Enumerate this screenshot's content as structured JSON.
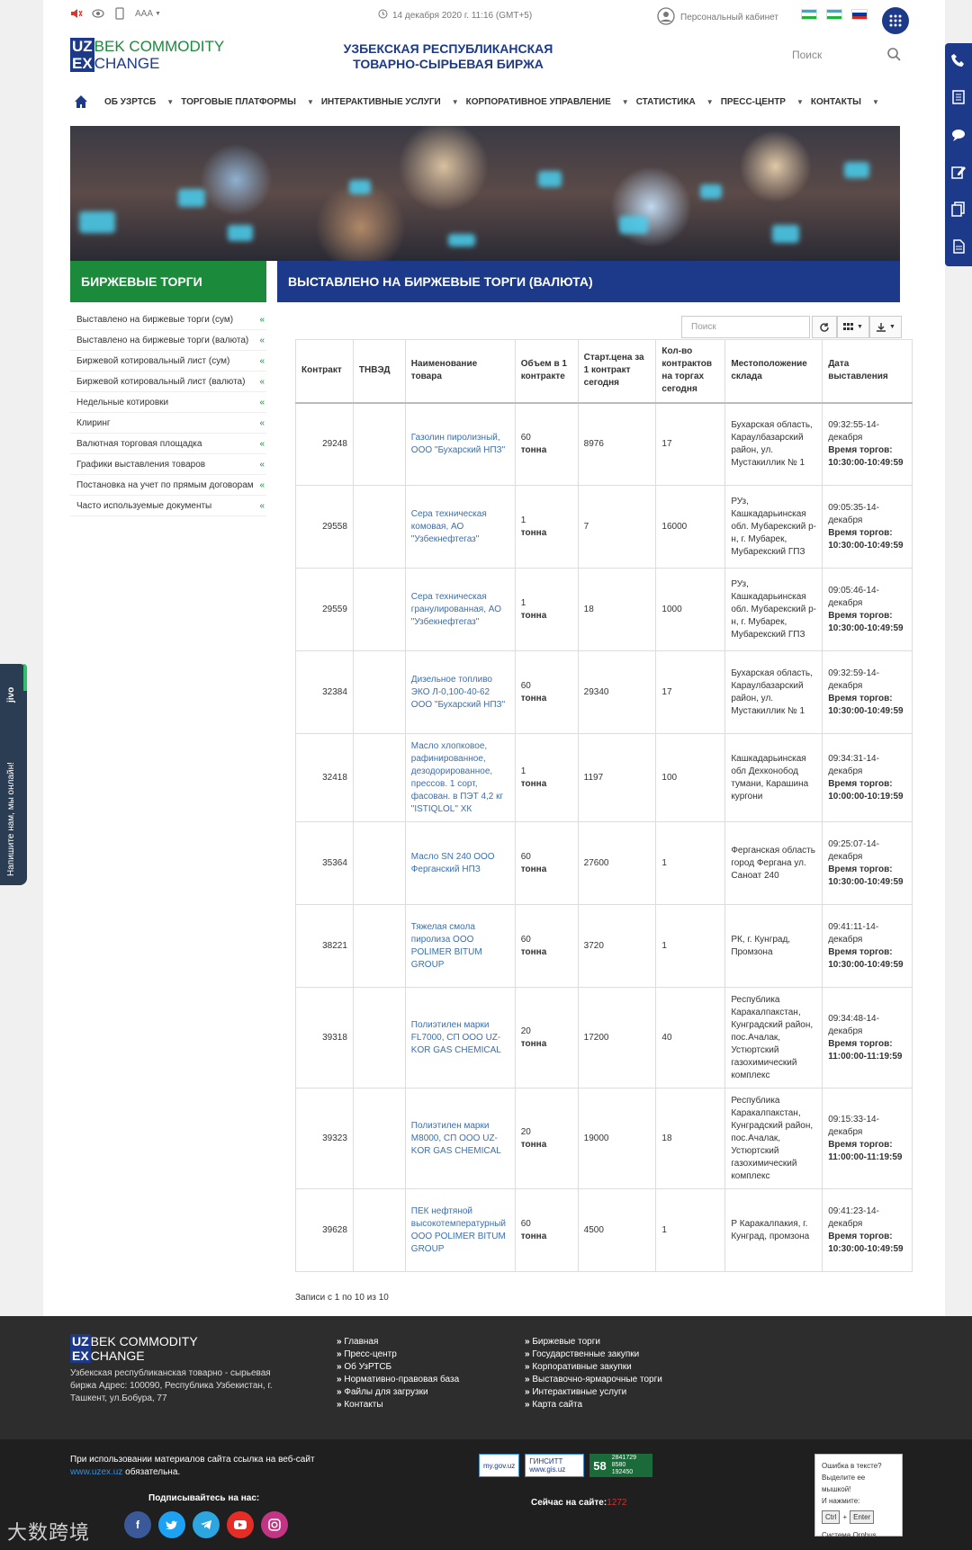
{
  "topbar": {
    "font_size_label": "AAA",
    "date": "14 декабря 2020 г. 11:16 (GMT+5)",
    "cabinet": "Персональный кабинет"
  },
  "header": {
    "logo": {
      "box1": "UZ",
      "text1": "BEK COMMODITY",
      "box2": "EX",
      "text2": "CHANGE"
    },
    "title": "УЗБЕКСКАЯ РЕСПУБЛИКАНСКАЯ ТОВАРНО-СЫРЬЕВАЯ БИРЖА",
    "search_placeholder": "Поиск"
  },
  "nav": [
    "ОБ УЗРТСБ",
    "ТОРГОВЫЕ ПЛАТФОРМЫ",
    "ИНТЕРАКТИВНЫЕ УСЛУГИ",
    "КОРПОРАТИВНОЕ УПРАВЛЕНИЕ",
    "СТАТИСТИКА",
    "ПРЕСС-ЦЕНТР",
    "КОНТАКТЫ"
  ],
  "section": {
    "left_title": "БИРЖЕВЫЕ ТОРГИ",
    "right_title": "ВЫСТАВЛЕНО НА БИРЖЕВЫЕ ТОРГИ (ВАЛЮТА)"
  },
  "left_menu": [
    "Выставлено на биржевые торги (сум)",
    "Выставлено на биржевые торги (валюта)",
    "Биржевой котировальный лист (сум)",
    "Биржевой котировальный лист (валюта)",
    "Недельные котировки",
    "Клиринг",
    "Валютная торговая площадка",
    "Графики выставления товаров",
    "Постановка на учет по прямым договорам",
    "Часто используемые документы"
  ],
  "table": {
    "search_placeholder": "Поиск",
    "columns": [
      "Контракт",
      "ТНВЭД",
      "Наименование товара",
      "Объем в 1 контракте",
      "Старт.цена за 1 контракт сегодня",
      "Кол-во контрактов на торгах сегодня",
      "Местоположение склада",
      "Дата выставления"
    ],
    "trade_time_label": "Время торгов:",
    "rows": [
      {
        "contract": "29248",
        "tnved": "",
        "name": "Газолин пиролизный, ООО \"Бухарский НПЗ\"",
        "volume": "60",
        "unit": "тонна",
        "price": "8976",
        "count": "17",
        "location": "Бухарская область, Караулбазарский район, ул. Мустакиллик № 1",
        "date": "09:32:55-14-декабря",
        "trade_time": "10:30:00-10:49:59"
      },
      {
        "contract": "29558",
        "tnved": "",
        "name": "Сера техническая комовая, АО \"Узбекнефтегаз\"",
        "volume": "1",
        "unit": "тонна",
        "price": "7",
        "count": "16000",
        "location": "РУз, Кашкадарьинская обл. Мубарекский р-н, г. Мубарек, Мубарекский ГПЗ",
        "date": "09:05:35-14-декабря",
        "trade_time": "10:30:00-10:49:59"
      },
      {
        "contract": "29559",
        "tnved": "",
        "name": "Сера техническая гранулированная, АО \"Узбекнефтегаз\"",
        "volume": "1",
        "unit": "тонна",
        "price": "18",
        "count": "1000",
        "location": "РУз, Кашкадарьинская обл. Мубарекский р-н, г. Мубарек, Мубарекский ГПЗ",
        "date": "09:05:46-14-декабря",
        "trade_time": "10:30:00-10:49:59"
      },
      {
        "contract": "32384",
        "tnved": "",
        "name": "Дизельное топливо ЭКО Л-0,100-40-62 ООО \"Бухарский НПЗ\"",
        "volume": "60",
        "unit": "тонна",
        "price": "29340",
        "count": "17",
        "location": "Бухарская область, Караулбазарский район, ул. Мустакиллик № 1",
        "date": "09:32:59-14-декабря",
        "trade_time": "10:30:00-10:49:59"
      },
      {
        "contract": "32418",
        "tnved": "",
        "name": "Масло хлопковое, рафинированное, дезодорированное, прессов. 1 сорт, фасован. в ПЭТ 4,2 кг \"ISTIQLOL\" ХК",
        "volume": "1",
        "unit": "тонна",
        "price": "1197",
        "count": "100",
        "location": "Кашкадарьинская обл Дехконобод тумани, Карашина кургони",
        "date": "09:34:31-14-декабря",
        "trade_time": "10:00:00-10:19:59"
      },
      {
        "contract": "35364",
        "tnved": "",
        "name": "Масло SN 240 ООО Ферганский НПЗ",
        "volume": "60",
        "unit": "тонна",
        "price": "27600",
        "count": "1",
        "location": "Ферганская область город Фергана ул. Саноат 240",
        "date": "09:25:07-14-декабря",
        "trade_time": "10:30:00-10:49:59"
      },
      {
        "contract": "38221",
        "tnved": "",
        "name": "Тяжелая смола пиролиза ООО POLIMER BITUM GROUP",
        "volume": "60",
        "unit": "тонна",
        "price": "3720",
        "count": "1",
        "location": "РК, г. Кунград, Промзона",
        "date": "09:41:11-14-декабря",
        "trade_time": "10:30:00-10:49:59"
      },
      {
        "contract": "39318",
        "tnved": "",
        "name": "Полиэтилен марки FL7000, СП ООО UZ-KOR GAS CHEMICAL",
        "volume": "20",
        "unit": "тонна",
        "price": "17200",
        "count": "40",
        "location": "Республика Каракалпакстан, Кунградский район, пос.Ачалак, Устюртский газохимический комплекс",
        "date": "09:34:48-14-декабря",
        "trade_time": "11:00:00-11:19:59"
      },
      {
        "contract": "39323",
        "tnved": "",
        "name": "Полиэтилен марки M8000, СП ООО UZ-KOR GAS CHEMICAL",
        "volume": "20",
        "unit": "тонна",
        "price": "19000",
        "count": "18",
        "location": "Республика Каракалпакстан, Кунградский район, пос.Ачалак, Устюртский газохимический комплекс",
        "date": "09:15:33-14-декабря",
        "trade_time": "11:00:00-11:19:59"
      },
      {
        "contract": "39628",
        "tnved": "",
        "name": "ПЕК нефтяной высокотемпературный ООО POLIMER BITUM GROUP",
        "volume": "60",
        "unit": "тонна",
        "price": "4500",
        "count": "1",
        "location": "Р Каракалпакия, г. Кунград, промзона",
        "date": "09:41:23-14-декабря",
        "trade_time": "10:30:00-10:49:59"
      }
    ],
    "records_info": "Записи с 1 по 10 из 10"
  },
  "footer": {
    "address": "Узбекская республиканская товарно - сырьевая биржа Адрес: 100090, Республика Узбекистан, г. Ташкент, ул.Бобура, 77",
    "col1": [
      "Главная",
      "Пресс-центр",
      "Об УзРТСБ",
      "Нормативно-правовая база",
      "Файлы для загрузки",
      "Контакты"
    ],
    "col2": [
      "Биржевые торги",
      "Государственные закупки",
      "Корпоративные закупки",
      "Выставочно-ярмарочные торги",
      "Интерактивные услуги",
      "Карта сайта"
    ],
    "copy_text": "При использовании материалов сайта ссылка на веб-сайт",
    "copy_link": "www.uzex.uz",
    "copy_tail": "обязательна.",
    "subscribe": "Подписывайтесь на нас:",
    "badges": [
      "my.gov.uz",
      "ГИНСИТТ www.gis.uz"
    ],
    "counter_value": "58",
    "counter_small1": "2841729",
    "counter_small2": "8580",
    "counter_small3": "192450",
    "online_label": "Сейчас на сайте:",
    "online_count": "1272",
    "orphus_line1": "Ошибка в тексте?",
    "orphus_line2": "Выделите ее мышкой!",
    "orphus_line3": "И нажмите:",
    "orphus_key1": "Ctrl",
    "orphus_key2": "Enter",
    "orphus_footer": "Система Orphus",
    "watermark": "大数跨境"
  },
  "jivo": {
    "brand": "jivo",
    "text": "Напишите нам, мы онлайн!"
  },
  "colors": {
    "brand_blue": "#1d3a8a",
    "brand_green": "#1b8a3a",
    "link": "#3a6fb0"
  }
}
